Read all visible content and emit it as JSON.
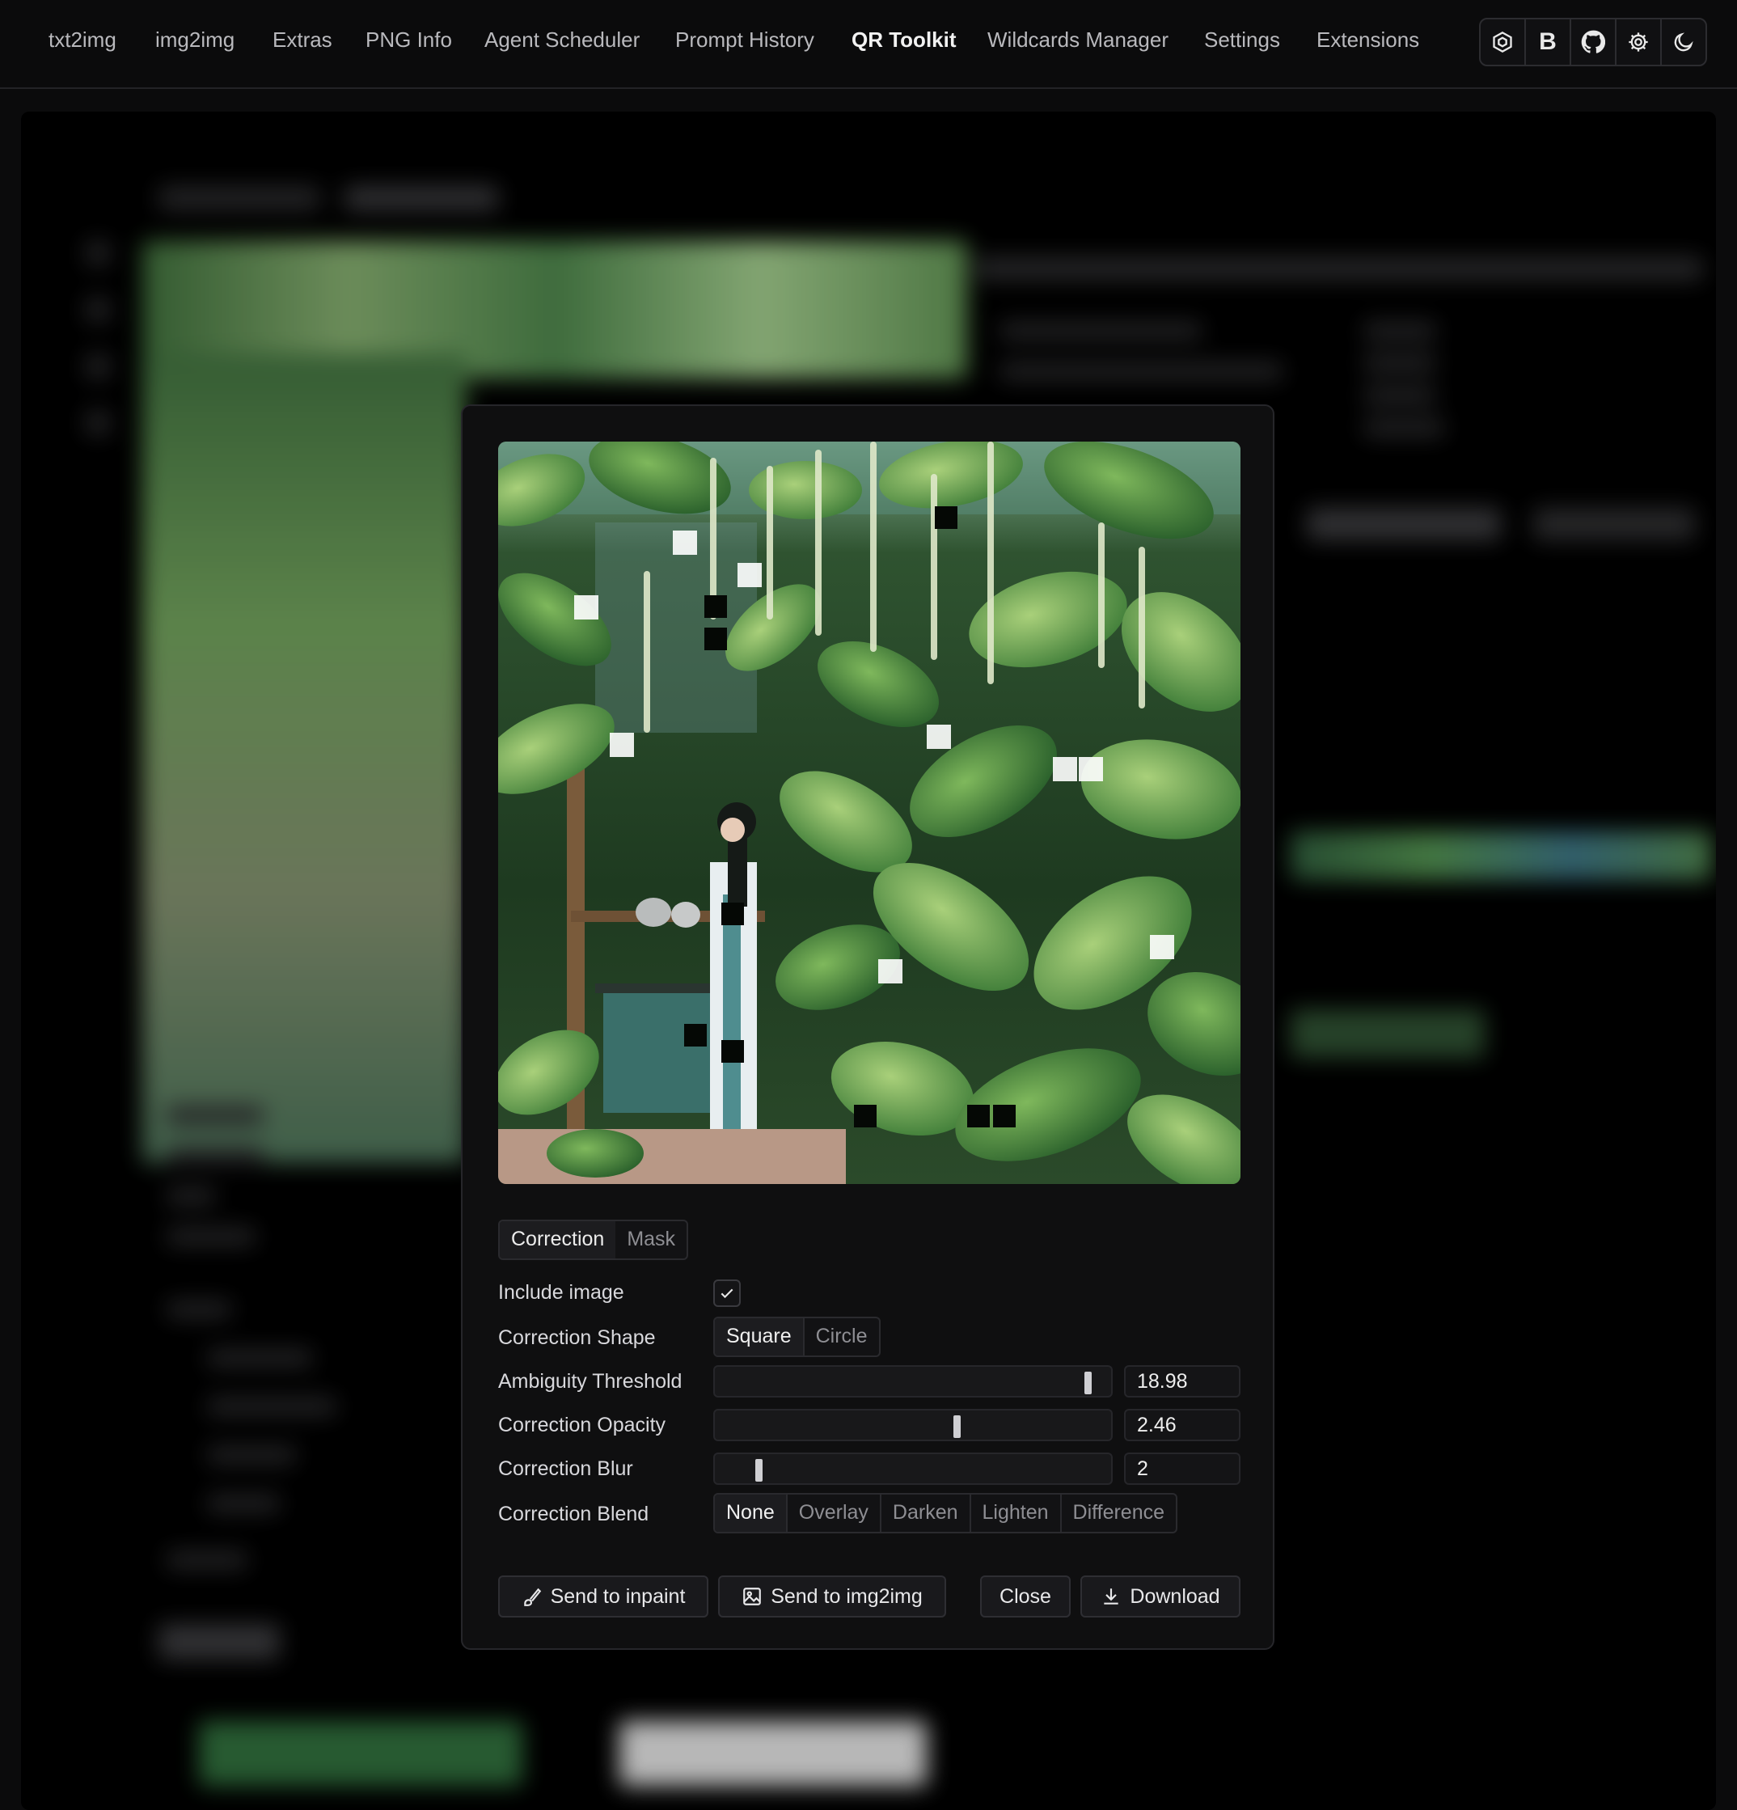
{
  "nav": {
    "tabs": [
      {
        "label": "txt2img"
      },
      {
        "label": "img2img"
      },
      {
        "label": "Extras"
      },
      {
        "label": "PNG Info"
      },
      {
        "label": "Agent Scheduler"
      },
      {
        "label": "Prompt History"
      },
      {
        "label": "QR Toolkit"
      },
      {
        "label": "Wildcards Manager"
      },
      {
        "label": "Settings"
      },
      {
        "label": "Extensions"
      }
    ],
    "active_tab": "QR Toolkit",
    "icons": [
      "hexagon-logo-icon",
      "bold-b-icon",
      "github-icon",
      "gear-icon",
      "moon-icon"
    ],
    "icon_b_text": "B"
  },
  "modal": {
    "tabs": [
      {
        "label": "Correction"
      },
      {
        "label": "Mask"
      }
    ],
    "active_tab": "Correction",
    "include_image": {
      "label": "Include image",
      "checked": true
    },
    "correction_shape": {
      "label": "Correction Shape",
      "options": [
        "Square",
        "Circle"
      ],
      "selected": "Square"
    },
    "ambiguity_threshold": {
      "label": "Ambiguity Threshold",
      "value": "18.98",
      "fill_fraction": 0.94
    },
    "correction_opacity": {
      "label": "Correction Opacity",
      "value": "2.46",
      "fill_fraction": 0.61
    },
    "correction_blur": {
      "label": "Correction Blur",
      "value": "2",
      "fill_fraction": 0.11
    },
    "correction_blend": {
      "label": "Correction Blend",
      "options": [
        "None",
        "Overlay",
        "Darken",
        "Lighten",
        "Difference"
      ],
      "selected": "None"
    },
    "buttons": {
      "send_inpaint": "Send to inpaint",
      "send_img2img": "Send to img2img",
      "close": "Close",
      "download": "Download"
    }
  },
  "colors": {
    "background": "#0b0b0c",
    "modal_bg": "#0f0f10",
    "foliage_dark": "#1f3a22",
    "foliage_light": "#5f9a4e"
  }
}
